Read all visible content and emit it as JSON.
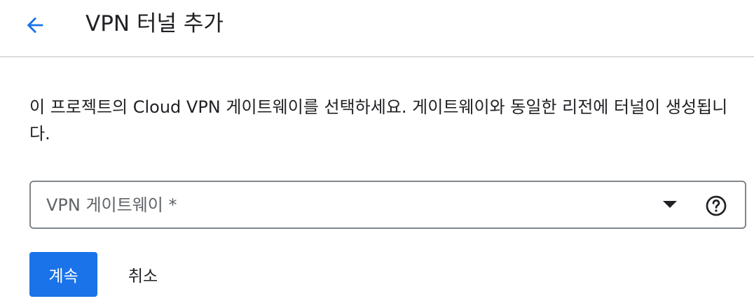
{
  "header": {
    "back_icon": "arrow-back-icon",
    "title": "VPN 터널 추가"
  },
  "main": {
    "description": "이 프로젝트의 Cloud VPN 게이트웨이를 선택하세요. 게이트웨이와 동일한 리전에 터널이 생성됩니다.",
    "vpn_gateway_select": {
      "label": "VPN 게이트웨이 *",
      "value": "",
      "dropdown_icon": "arrow-drop-down-icon",
      "help_icon": "help-outline-icon"
    }
  },
  "actions": {
    "continue_label": "계속",
    "cancel_label": "취소"
  },
  "colors": {
    "primary": "#1a73e8",
    "text": "#202124",
    "muted_text": "#5f6368",
    "border": "#80868b",
    "divider": "#dadce0"
  }
}
